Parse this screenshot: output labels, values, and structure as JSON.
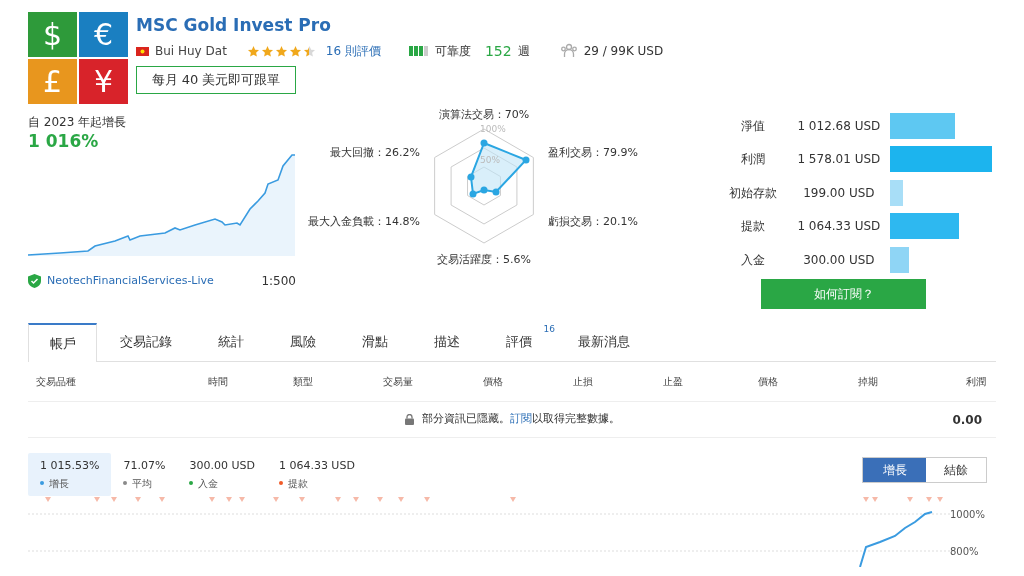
{
  "logo": {
    "tiles": [
      {
        "symbol": "$",
        "color": "#2e9a3a"
      },
      {
        "symbol": "€",
        "color": "#1a7fc1"
      },
      {
        "symbol": "£",
        "color": "#e8961e"
      },
      {
        "symbol": "¥",
        "color": "#d8232a"
      }
    ]
  },
  "header": {
    "title": "MSC Gold Invest Pro",
    "author": "Bui Huy Dat",
    "stars": 4.5,
    "reviews": "16 則評價",
    "reliability_label": "可靠度",
    "weeks": "152",
    "weeks_unit": "週",
    "subscribers": "29 / 99K USD",
    "subscribe_button": "每月 40 美元即可跟單"
  },
  "growth": {
    "label": "自 2023 年起增長",
    "value": "1 016%",
    "broker": "NeotechFinancialServices-Live",
    "leverage": "1:500"
  },
  "radar": {
    "top": "演算法交易：70%",
    "upper_left": "最大回撤：26.2%",
    "upper_right": "盈利交易：79.9%",
    "lower_left": "最大入金負載：14.8%",
    "lower_right": "虧損交易：20.1%",
    "bottom": "交易活躍度：5.6%",
    "tick_outer": "100%",
    "tick_inner": "50%"
  },
  "stats": [
    {
      "label": "淨值",
      "value": "1 012.68 USD",
      "color": "#5ec8f2"
    },
    {
      "label": "利潤",
      "value": "1 578.01 USD",
      "color": "#1cb4ee"
    },
    {
      "label": "初始存款",
      "value": "199.00 USD",
      "color": "#a8def7"
    },
    {
      "label": "提款",
      "value": "1 064.33 USD",
      "color": "#2eb8f0"
    },
    {
      "label": "入金",
      "value": "300.00 USD",
      "color": "#8fd5f5"
    }
  ],
  "how_to_subscribe": "如何訂閱？",
  "tabs": [
    {
      "label": "帳戶",
      "selected": true
    },
    {
      "label": "交易記錄",
      "selected": false
    },
    {
      "label": "統計",
      "selected": false
    },
    {
      "label": "風險",
      "selected": false
    },
    {
      "label": "滑點",
      "selected": false
    },
    {
      "label": "描述",
      "selected": false
    },
    {
      "label": "評價",
      "selected": false,
      "badge": "16"
    },
    {
      "label": "最新消息",
      "selected": false
    }
  ],
  "table": {
    "columns": [
      "交易品種",
      "時間",
      "類型",
      "交易量",
      "價格",
      "止損",
      "止盈",
      "價格",
      "掉期",
      "利潤"
    ],
    "notice_before": "部分資訊已隱藏。",
    "notice_link": "訂閱",
    "notice_after": "以取得完整數據。",
    "total": "0.00"
  },
  "summary": [
    {
      "value": "1 015.53%",
      "label": "增長",
      "color": "#3a9be0",
      "selected": true
    },
    {
      "value": "71.07%",
      "label": "平均",
      "color": "#8a8a8a",
      "selected": false
    },
    {
      "value": "300.00 USD",
      "label": "入金",
      "color": "#2aa745",
      "selected": false
    },
    {
      "value": "1 064.33 USD",
      "label": "提款",
      "color": "#f05a28",
      "selected": false
    }
  ],
  "chart_toggle": [
    {
      "label": "增長",
      "selected": true
    },
    {
      "label": "結餘",
      "selected": false
    }
  ],
  "chart_ticks": [
    "1000%",
    "800%"
  ]
}
